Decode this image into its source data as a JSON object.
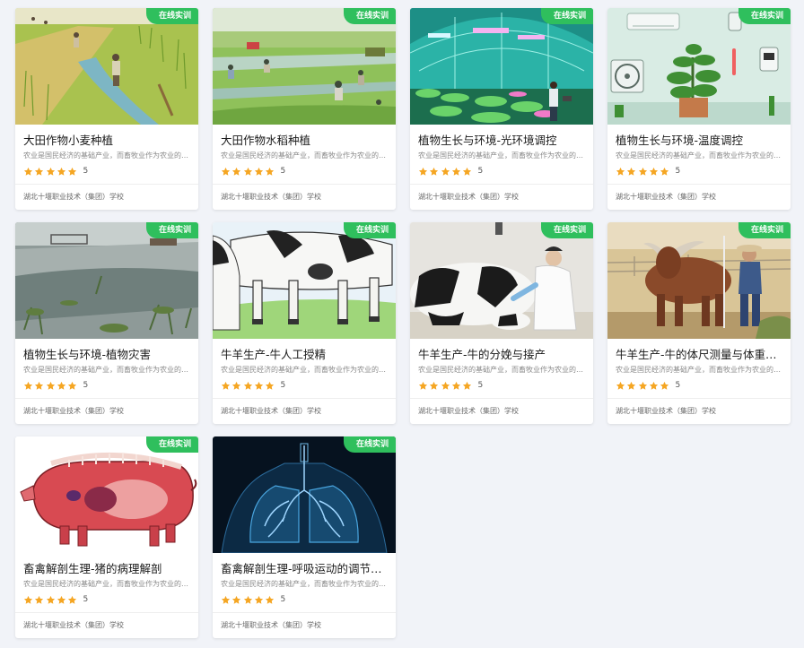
{
  "colors": {
    "badge": "#2fbf5d",
    "star": "#f5a623",
    "background": "#f1f3f8"
  },
  "cards": [
    {
      "title": "大田作物小麦种植",
      "badge": "在线实训",
      "description": "农业是国民经济的基础产业，而畜牧业作为农业的…",
      "score": "5",
      "school": "湖北十堰职业技术（集团）学校",
      "rating": 5,
      "image": "wheat-field-farmers"
    },
    {
      "title": "大田作物水稻种植",
      "badge": "在线实训",
      "description": "农业是国民经济的基础产业，而畜牧业作为农业的…",
      "score": "5",
      "school": "湖北十堰职业技术（集团）学校",
      "rating": 5,
      "image": "rice-paddy-farmers"
    },
    {
      "title": "植物生长与环境-光环境调控",
      "badge": "在线实训",
      "description": "农业是国民经济的基础产业，而畜牧业作为农业的…",
      "score": "5",
      "school": "湖北十堰职业技术（集团）学校",
      "rating": 5,
      "image": "greenhouse-grow-lights"
    },
    {
      "title": "植物生长与环境-温度调控",
      "badge": "在线实训",
      "description": "农业是国民经济的基础产业，而畜牧业作为农业的…",
      "score": "5",
      "school": "湖北十堰职业技术（集团）学校",
      "rating": 5,
      "image": "indoor-plant-ac"
    },
    {
      "title": "植物生长与环境-植物灾害",
      "badge": "在线实训",
      "description": "农业是国民经济的基础产业，而畜牧业作为农业的…",
      "score": "5",
      "school": "湖北十堰职业技术（集团）学校",
      "rating": 5,
      "image": "flooded-crops"
    },
    {
      "title": "牛羊生产-牛人工授精",
      "badge": "在线实训",
      "description": "农业是国民经济的基础产业，而畜牧业作为农业的…",
      "score": "5",
      "school": "湖北十堰职业技术（集团）学校",
      "rating": 5,
      "image": "cows-illustration"
    },
    {
      "title": "牛羊生产-牛的分娩与接产",
      "badge": "在线实训",
      "description": "农业是国民经济的基础产业，而畜牧业作为农业的…",
      "score": "5",
      "school": "湖北十堰职业技术（集团）学校",
      "rating": 5,
      "image": "cow-calving-vet"
    },
    {
      "title": "牛羊生产-牛的体尺测量与体重估测",
      "badge": "在线实训",
      "description": "农业是国民经济的基础产业，而畜牧业作为农业的…",
      "score": "5",
      "school": "湖北十堰职业技术（集团）学校",
      "rating": 5,
      "image": "bull-measuring"
    },
    {
      "title": "畜禽解剖生理-猪的病理解剖",
      "badge": "在线实训",
      "description": "农业是国民经济的基础产业，而畜牧业作为农业的…",
      "score": "5",
      "school": "湖北十堰职业技术（集团）学校",
      "rating": 5,
      "image": "pig-anatomy"
    },
    {
      "title": "畜禽解剖生理-呼吸运动的调节模…",
      "badge": "在线实训",
      "description": "农业是国民经济的基础产业，而畜牧业作为农业的…",
      "score": "5",
      "school": "湖北十堰职业技术（集团）学校",
      "rating": 5,
      "image": "lungs-xray"
    }
  ]
}
